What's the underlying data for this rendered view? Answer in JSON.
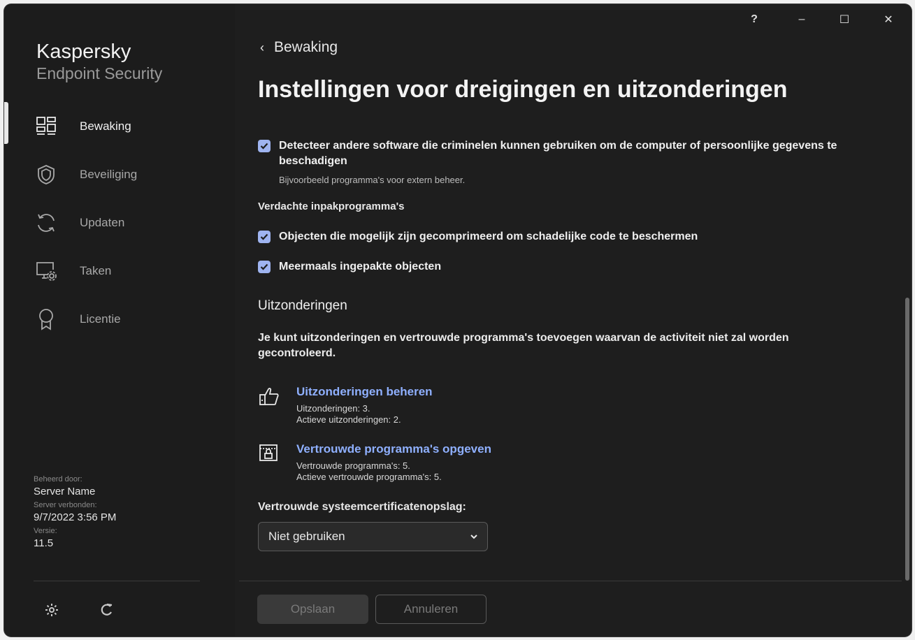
{
  "window": {
    "controls": {
      "help": "?",
      "minimize": "–",
      "maximize": "☐",
      "close": "✕"
    }
  },
  "brand": {
    "line1": "Kaspersky",
    "line2": "Endpoint Security"
  },
  "sidebar": {
    "items": [
      {
        "label": "Bewaking",
        "icon": "dashboard-icon",
        "active": true
      },
      {
        "label": "Beveiliging",
        "icon": "shield-icon",
        "active": false
      },
      {
        "label": "Updaten",
        "icon": "refresh-icon",
        "active": false
      },
      {
        "label": "Taken",
        "icon": "monitor-gear-icon",
        "active": false
      },
      {
        "label": "Licentie",
        "icon": "award-icon",
        "active": false
      }
    ],
    "meta": {
      "managed_by_label": "Beheerd door:",
      "managed_by_value": "Server Name",
      "server_connected_label": "Server verbonden:",
      "server_connected_value": "9/7/2022 3:56 PM",
      "version_label": "Versie:",
      "version_value": "11.5"
    }
  },
  "main": {
    "back_label": "Bewaking",
    "title": "Instellingen voor dreigingen en uitzonderingen",
    "detect_other": {
      "label": "Detecteer andere software die criminelen kunnen gebruiken om de computer of persoonlijke gegevens te beschadigen",
      "sub": "Bijvoorbeeld programma's voor extern beheer.",
      "checked": true
    },
    "packers_label": "Verdachte inpakprogramma's",
    "packed_objects": {
      "label": "Objecten die mogelijk zijn gecomprimeerd om schadelijke code te beschermen",
      "checked": true
    },
    "multipacked": {
      "label": "Meermaals ingepakte objecten",
      "checked": true
    },
    "exclusions_heading": "Uitzonderingen",
    "exclusions_desc": "Je kunt uitzonderingen en vertrouwde programma's toevoegen waarvan de activiteit niet zal worden gecontroleerd.",
    "manage_exclusions": {
      "link": "Uitzonderingen beheren",
      "line1": "Uitzonderingen: 3.",
      "line2": "Actieve uitzonderingen: 2."
    },
    "trusted_apps": {
      "link": "Vertrouwde programma's opgeven",
      "line1": "Vertrouwde programma's: 5.",
      "line2": "Actieve vertrouwde programma's: 5."
    },
    "cert_store_label": "Vertrouwde systeemcertificatenopslag:",
    "cert_store_value": "Niet gebruiken"
  },
  "footer": {
    "save_label": "Opslaan",
    "cancel_label": "Annuleren"
  },
  "colors": {
    "accent": "#8fb0ff",
    "checkbox": "#9fb4f0",
    "background": "#1e1e1e"
  }
}
